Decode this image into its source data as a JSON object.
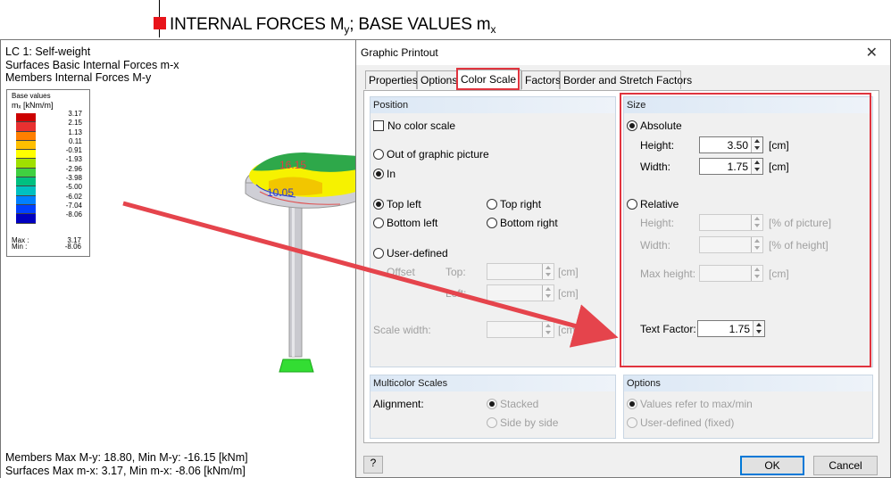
{
  "header": {
    "title_main": "INTERNAL FORCES M",
    "title_sub1": "y",
    "title_mid": "; BASE VALUES m",
    "title_sub2": "x"
  },
  "graphic": {
    "info_lines": [
      "LC 1: Self-weight",
      "Surfaces Basic Internal Forces m-x",
      "Members Internal Forces M-y"
    ],
    "legend": {
      "title": "Base values",
      "unit": "mₓ [kNm/m]",
      "values": [
        "3.17",
        "2.15",
        "1.13",
        "0.11",
        "-0.91",
        "-1.93",
        "-2.96",
        "-3.98",
        "-5.00",
        "-6.02",
        "-7.04",
        "-8.06"
      ],
      "colors": [
        "#cc0000",
        "#e83030",
        "#ff7f00",
        "#ffbf00",
        "#ffff00",
        "#a0e000",
        "#40d040",
        "#00c080",
        "#00c0c0",
        "#0080ff",
        "#0040ff",
        "#0000c0"
      ],
      "max_label": "Max :",
      "max_value": "3.17",
      "min_label": "Min :",
      "min_value": "-8.06"
    },
    "model_labels": [
      "16.15",
      "10.05"
    ],
    "footer_lines": [
      "Members Max M-y: 18.80, Min M-y: -16.15 [kNm]",
      "Surfaces Max m-x: 3.17, Min m-x: -8.06 [kNm/m]"
    ]
  },
  "dialog": {
    "title": "Graphic Printout",
    "close_glyph": "✕",
    "tabs": [
      "Properties",
      "Options",
      "Color Scale",
      "Factors",
      "Border and Stretch Factors"
    ],
    "active_tab": "Color Scale",
    "position": {
      "header": "Position",
      "no_color_scale": "No color scale",
      "out_of_graphic": "Out of graphic picture",
      "in": "In",
      "top_left": "Top left",
      "top_right": "Top right",
      "bottom_left": "Bottom left",
      "bottom_right": "Bottom right",
      "user_defined": "User-defined",
      "offset": "Offset",
      "top": "Top:",
      "left": "Left:",
      "scale_width": "Scale width:",
      "unit_cm": "[cm]"
    },
    "size": {
      "header": "Size",
      "absolute": "Absolute",
      "height_label": "Height:",
      "height_value": "3.50",
      "width_label": "Width:",
      "width_value": "1.75",
      "unit_cm": "[cm]",
      "relative": "Relative",
      "rel_height_label": "Height:",
      "rel_height_unit": "[% of picture]",
      "rel_width_label": "Width:",
      "rel_width_unit": "[% of height]",
      "max_height_label": "Max height:",
      "max_height_unit": "[cm]",
      "text_factor_label": "Text Factor:",
      "text_factor_value": "1.75"
    },
    "multicolor": {
      "header": "Multicolor Scales",
      "alignment": "Alignment:",
      "stacked": "Stacked",
      "side_by_side": "Side by side"
    },
    "options": {
      "header": "Options",
      "values_refer": "Values refer to max/min",
      "user_defined_fixed": "User-defined (fixed)"
    },
    "buttons": {
      "ok": "OK",
      "cancel": "Cancel",
      "help_glyph": "?"
    }
  },
  "colors": {
    "highlight": "#e0343e",
    "group_header": "#dce8f5"
  }
}
